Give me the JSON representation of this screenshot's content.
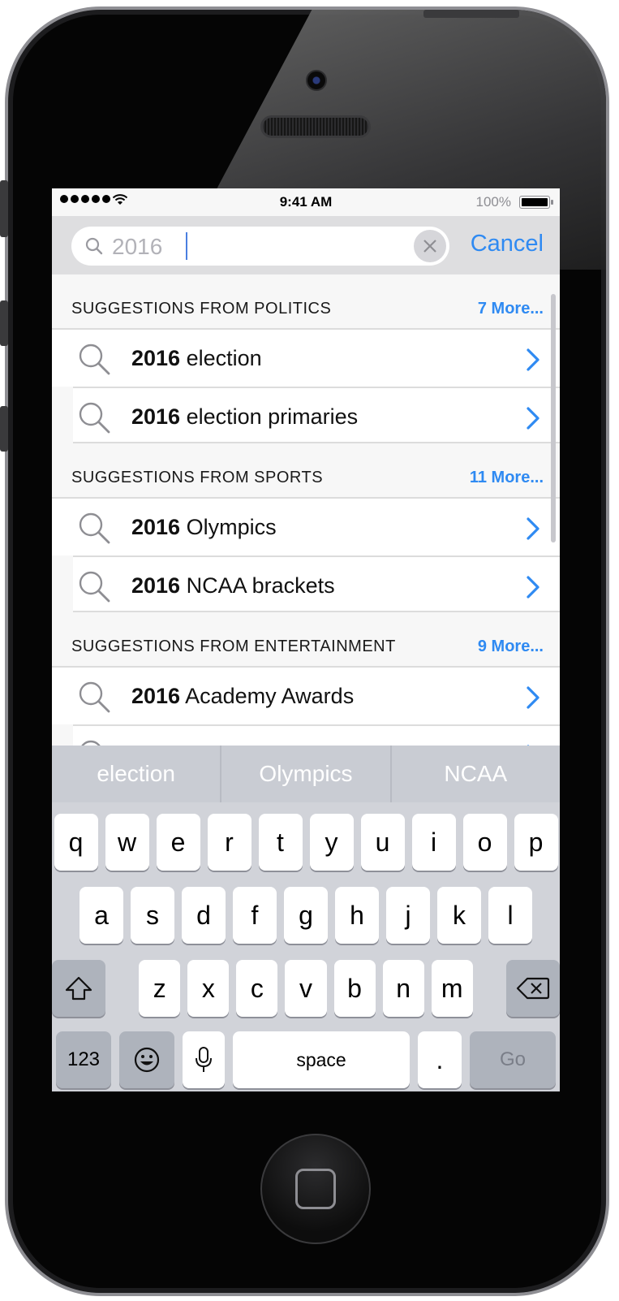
{
  "status_bar": {
    "time": "9:41 AM",
    "battery_percent": "100%"
  },
  "search": {
    "value": "2016",
    "cancel_label": "Cancel"
  },
  "sections": [
    {
      "title": "SUGGESTIONS FROM POLITICS",
      "more": "7 More...",
      "items": [
        {
          "bold": "2016",
          "text": " election"
        },
        {
          "bold": "2016",
          "text": " election primaries"
        }
      ]
    },
    {
      "title": "SUGGESTIONS FROM SPORTS",
      "more": "11 More...",
      "items": [
        {
          "bold": "2016",
          "text": " Olympics"
        },
        {
          "bold": "2016",
          "text": " NCAA brackets"
        }
      ]
    },
    {
      "title": "SUGGESTIONS FROM ENTERTAINMENT",
      "more": "9 More...",
      "items": [
        {
          "bold": "2016",
          "text": " Academy Awards"
        }
      ]
    }
  ],
  "keyboard": {
    "predictions": [
      "election",
      "Olympics",
      "NCAA"
    ],
    "row1": [
      "q",
      "w",
      "e",
      "r",
      "t",
      "y",
      "u",
      "i",
      "o",
      "p"
    ],
    "row2": [
      "a",
      "s",
      "d",
      "f",
      "g",
      "h",
      "j",
      "k",
      "l"
    ],
    "row3": [
      "z",
      "x",
      "c",
      "v",
      "b",
      "n",
      "m"
    ],
    "numbers_label": "123",
    "space_label": "space",
    "period_label": ".",
    "go_label": "Go"
  },
  "colors": {
    "accent": "#2f8af2",
    "keyboard_bg": "#d1d3d9"
  }
}
